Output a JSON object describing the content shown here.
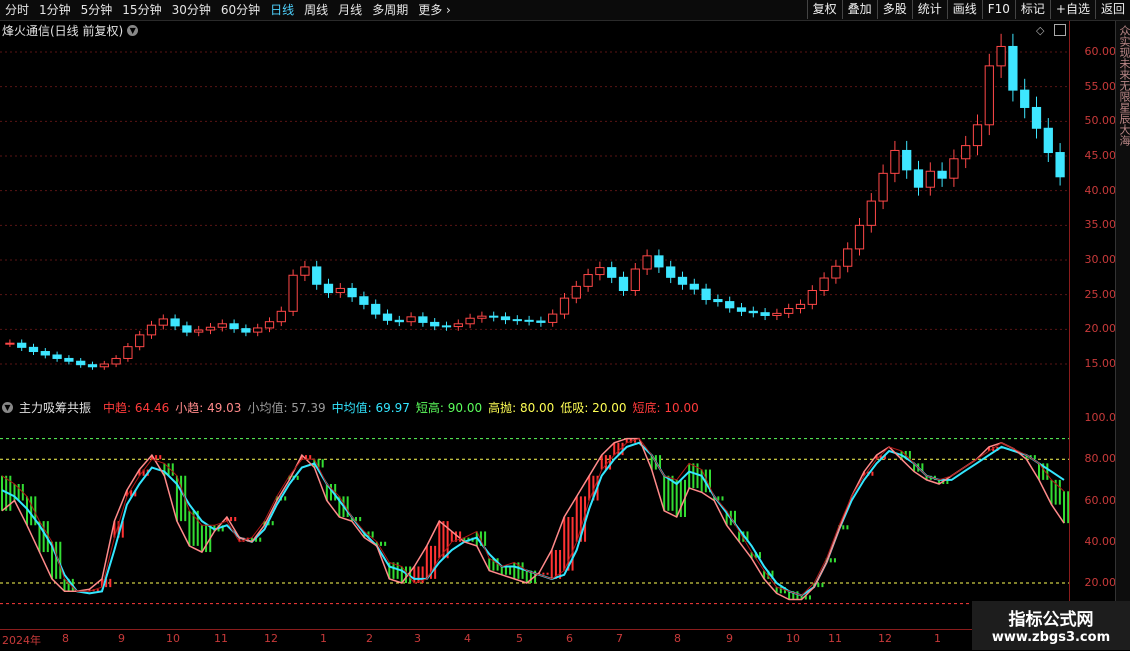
{
  "toolbar": {
    "tabs": [
      "分时",
      "1分钟",
      "5分钟",
      "15分钟",
      "30分钟",
      "60分钟",
      "日线",
      "周线",
      "月线",
      "多周期",
      "更多"
    ],
    "active_tab": "日线",
    "right_buttons": [
      "复权",
      "叠加",
      "多股",
      "统计",
      "画线",
      "F10",
      "标记",
      "+自选",
      "返回"
    ]
  },
  "main_panel": {
    "title": "烽火通信(日线 前复权)",
    "y_ticks": [
      "60.00",
      "55.00",
      "50.00",
      "45.00",
      "40.00",
      "35.00",
      "30.00",
      "25.00",
      "20.00",
      "15.00"
    ]
  },
  "indicator_panel": {
    "title": "主力吸筹共振",
    "legend": [
      {
        "label": "中趋: 64.46",
        "color": "#ff3b3b"
      },
      {
        "label": "小趋: 49.03",
        "color": "#ff8a8a"
      },
      {
        "label": "小均值: 57.39",
        "color": "#9a9a9a"
      },
      {
        "label": "中均值: 69.97",
        "color": "#33e6ff"
      },
      {
        "label": "短高: 90.00",
        "color": "#5cff5c"
      },
      {
        "label": "高抛: 80.00",
        "color": "#ffff55"
      },
      {
        "label": "低吸: 20.00",
        "color": "#ffff55"
      },
      {
        "label": "短底: 10.00",
        "color": "#ff3b3b"
      }
    ],
    "y_ticks": [
      "100.0",
      "80.00",
      "60.00",
      "40.00",
      "20.00"
    ]
  },
  "x_axis": {
    "labels": [
      "2024年",
      "8",
      "9",
      "10",
      "11",
      "12",
      "1",
      "2",
      "3",
      "4",
      "5",
      "6",
      "7",
      "8",
      "9",
      "10",
      "11",
      "12",
      "1"
    ]
  },
  "sidebar": {
    "text": "众实现未来无限星辰大海"
  },
  "watermark": {
    "title": "指标公式网",
    "url": "www.zbgs3.com"
  },
  "chart_data": {
    "type": "line",
    "title": "烽火通信(日线 前复权)",
    "series": [
      {
        "name": "close",
        "values": [
          18.0,
          17.4,
          16.8,
          16.3,
          15.8,
          15.4,
          14.9,
          14.6,
          15.0,
          15.8,
          17.5,
          19.2,
          20.6,
          21.5,
          20.5,
          19.6,
          19.9,
          20.3,
          20.8,
          20.1,
          19.6,
          20.2,
          21.1,
          22.6,
          27.8,
          29.0,
          26.5,
          25.3,
          25.9,
          24.7,
          23.6,
          22.2,
          21.3,
          21.1,
          21.8,
          21.0,
          20.5,
          20.4,
          20.8,
          21.6,
          21.9,
          21.8,
          21.4,
          21.3,
          21.2,
          21.0,
          22.2,
          24.5,
          26.2,
          27.9,
          28.9,
          27.5,
          25.6,
          28.7,
          30.6,
          29.0,
          27.5,
          26.5,
          25.8,
          24.3,
          24.0,
          23.1,
          22.6,
          22.4,
          22.0,
          22.3,
          23.0,
          23.6,
          25.6,
          27.4,
          29.1,
          31.6,
          35.0,
          38.5,
          42.5,
          45.8,
          43.0,
          40.5,
          42.8,
          41.8,
          44.6,
          46.5,
          49.5,
          58.0,
          60.8,
          54.5,
          52.0,
          49.0,
          45.5,
          42.0
        ]
      },
      {
        "name": "中趋",
        "values": [
          72,
          68,
          62,
          50,
          40,
          22,
          16,
          16,
          18,
          42,
          62,
          72,
          80,
          78,
          72,
          55,
          48,
          48,
          50,
          40,
          42,
          50,
          62,
          72,
          80,
          80,
          68,
          62,
          52,
          45,
          40,
          30,
          28,
          20,
          22,
          32,
          40,
          42,
          45,
          32,
          28,
          30,
          26,
          24,
          22,
          26,
          40,
          60,
          75,
          82,
          88,
          90,
          82,
          72,
          70,
          78,
          75,
          62,
          55,
          45,
          35,
          26,
          18,
          16,
          14,
          20,
          32,
          48,
          62,
          72,
          80,
          86,
          84,
          78,
          72,
          70,
          72,
          76,
          80,
          84,
          88,
          85,
          82,
          78,
          70,
          64.46
        ]
      },
      {
        "name": "小趋",
        "values": [
          55,
          60,
          48,
          35,
          22,
          16,
          16,
          17,
          22,
          50,
          65,
          75,
          82,
          72,
          50,
          38,
          35,
          45,
          52,
          42,
          40,
          48,
          60,
          70,
          82,
          76,
          60,
          52,
          50,
          42,
          38,
          22,
          20,
          28,
          38,
          50,
          45,
          40,
          38,
          26,
          24,
          22,
          20,
          25,
          36,
          52,
          62,
          72,
          82,
          88,
          90,
          90,
          75,
          55,
          52,
          66,
          64,
          60,
          48,
          40,
          32,
          22,
          15,
          12,
          12,
          18,
          30,
          46,
          62,
          74,
          82,
          86,
          80,
          74,
          70,
          68,
          72,
          76,
          80,
          86,
          88,
          85,
          80,
          70,
          58,
          49.03
        ]
      },
      {
        "name": "中均值",
        "values": [
          65,
          62,
          56,
          48,
          38,
          24,
          16,
          15,
          16,
          36,
          58,
          68,
          76,
          74,
          68,
          58,
          50,
          46,
          48,
          42,
          40,
          46,
          58,
          68,
          76,
          78,
          68,
          60,
          52,
          44,
          38,
          28,
          26,
          22,
          22,
          30,
          36,
          40,
          42,
          34,
          28,
          28,
          26,
          24,
          22,
          24,
          36,
          56,
          72,
          80,
          86,
          88,
          82,
          72,
          68,
          74,
          72,
          62,
          54,
          46,
          38,
          28,
          20,
          16,
          14,
          18,
          30,
          46,
          60,
          70,
          78,
          84,
          82,
          78,
          72,
          70,
          70,
          74,
          78,
          82,
          86,
          84,
          82,
          78,
          74,
          69.97
        ]
      }
    ],
    "y_ticks_price": [
      60,
      55,
      50,
      45,
      40,
      35,
      30,
      25,
      20,
      15
    ],
    "y_ticks_indicator": [
      100,
      80,
      60,
      40,
      20
    ],
    "levels": {
      "短高": 90,
      "高抛": 80,
      "低吸": 20,
      "短底": 10
    },
    "x_ticks": [
      "2024年",
      "8",
      "9",
      "10",
      "11",
      "12",
      "1",
      "2",
      "3",
      "4",
      "5",
      "6",
      "7",
      "8",
      "9",
      "10",
      "11",
      "12",
      "1"
    ]
  }
}
